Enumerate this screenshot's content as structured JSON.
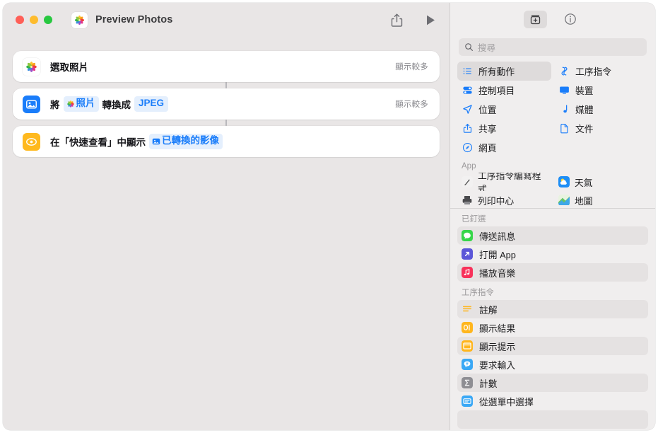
{
  "window": {
    "title": "Preview Photos",
    "app_icon": "photos-app-icon",
    "traffic_lights": [
      "close",
      "minimize",
      "zoom"
    ],
    "toolbar": [
      {
        "name": "share-button",
        "icon": "share-icon"
      },
      {
        "name": "run-button",
        "icon": "play-icon"
      }
    ]
  },
  "workflow": {
    "actions": [
      {
        "icon": "photos-app-icon",
        "icon_style": "photos",
        "prefix": "選取照片",
        "tokens": [],
        "suffix": "",
        "show_more": "顯示較多"
      },
      {
        "icon": "image-convert-icon",
        "icon_style": "convert",
        "prefix": "將",
        "tokens": [
          {
            "label": "照片",
            "icon": "photos-flower-icon"
          },
          {
            "label": "JPEG",
            "icon": ""
          }
        ],
        "mid": "轉換成",
        "suffix": "",
        "show_more": "顯示較多"
      },
      {
        "icon": "quick-look-eye-icon",
        "icon_style": "quicklook",
        "prefix": "在「快速查看」中顯示",
        "tokens": [
          {
            "label": "已轉換的影像",
            "icon": "image-token-icon"
          }
        ],
        "suffix": "",
        "show_more": ""
      }
    ]
  },
  "library": {
    "header_buttons": [
      {
        "name": "action-library-button",
        "icon": "action-library-icon",
        "selected": true
      },
      {
        "name": "info-button",
        "icon": "info-circle-icon",
        "selected": false
      }
    ],
    "search": {
      "placeholder": "搜尋",
      "value": "",
      "icon": "search-icon"
    },
    "categories": [
      {
        "label": "所有動作",
        "icon": "list-bullet-icon",
        "selected": true
      },
      {
        "label": "工序指令",
        "icon": "shortcuts-icon",
        "selected": false
      },
      {
        "label": "控制項目",
        "icon": "controls-icon",
        "selected": false
      },
      {
        "label": "裝置",
        "icon": "display-icon",
        "selected": false
      },
      {
        "label": "位置",
        "icon": "location-arrow-icon",
        "selected": false
      },
      {
        "label": "媒體",
        "icon": "music-note-icon",
        "selected": false
      },
      {
        "label": "共享",
        "icon": "share-up-icon",
        "selected": false
      },
      {
        "label": "文件",
        "icon": "document-icon",
        "selected": false
      },
      {
        "label": "網頁",
        "icon": "safari-compass-icon",
        "selected": false
      }
    ],
    "app_section": {
      "title": "App",
      "apps": [
        {
          "label": "工序指令編寫程式",
          "icon": "script-editor-icon"
        },
        {
          "label": "天氣",
          "icon": "weather-icon"
        },
        {
          "label": "列印中心",
          "icon": "printer-icon"
        },
        {
          "label": "地圖",
          "icon": "maps-icon"
        }
      ]
    },
    "pinned_section": {
      "title": "已釘選",
      "items": [
        {
          "label": "傳送訊息",
          "icon": "messages-icon",
          "highlighted": true
        },
        {
          "label": "打開 App",
          "icon": "open-app-icon",
          "highlighted": false
        },
        {
          "label": "播放音樂",
          "icon": "music-app-icon",
          "highlighted": true
        }
      ]
    },
    "shortcuts_section": {
      "title": "工序指令",
      "items": [
        {
          "label": "註解",
          "icon": "comment-icon",
          "highlighted": true
        },
        {
          "label": "顯示結果",
          "icon": "show-result-icon",
          "highlighted": false
        },
        {
          "label": "顯示提示",
          "icon": "show-alert-icon",
          "highlighted": true
        },
        {
          "label": "要求輸入",
          "icon": "ask-input-icon",
          "highlighted": false
        },
        {
          "label": "計數",
          "icon": "count-sigma-icon",
          "highlighted": true
        },
        {
          "label": "從選單中選擇",
          "icon": "choose-from-menu-icon",
          "highlighted": false
        }
      ]
    }
  },
  "colors": {
    "accent_blue": "#1a7dfa",
    "canvas_bg": "#e9e6e6",
    "panel_bg": "#f0eeee",
    "card_bg": "#ffffff",
    "token_bg": "#e4effd",
    "quicklook_yellow": "#ffb91e"
  }
}
